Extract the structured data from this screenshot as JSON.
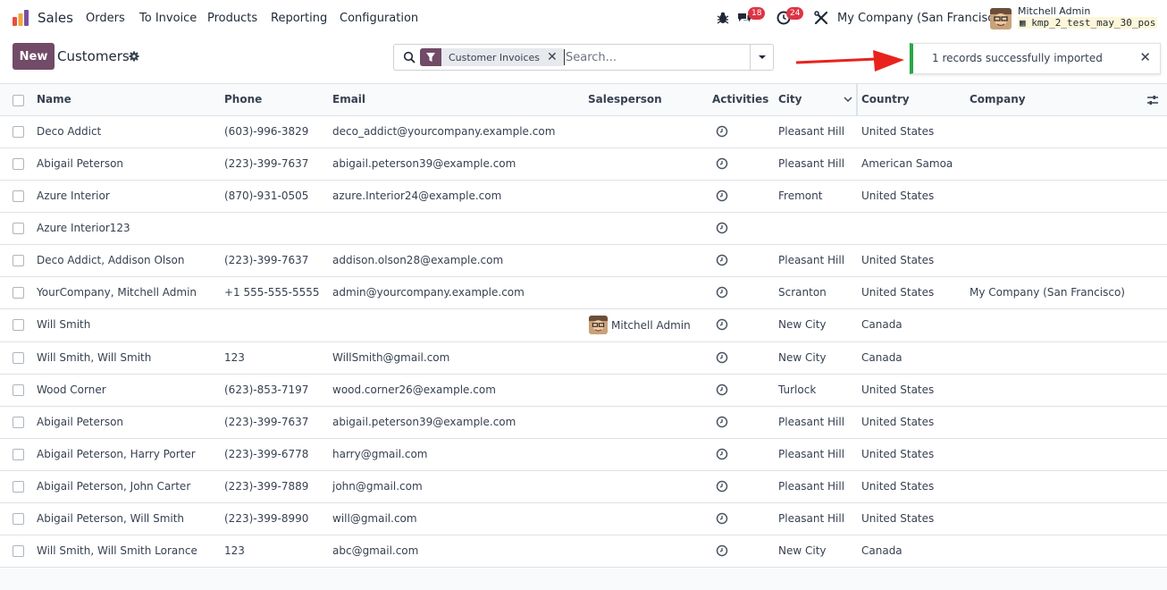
{
  "navbar": {
    "app_name": "Sales",
    "menu": [
      "Orders",
      "To Invoice",
      "Products",
      "Reporting",
      "Configuration"
    ],
    "messages_count": "18",
    "activities_count": "24",
    "company": "My Company (San Francisco)",
    "user_name": "Mitchell Admin",
    "database": "kmp_2_test_may_30_pos"
  },
  "control_panel": {
    "new_label": "New",
    "breadcrumb": "Customers"
  },
  "search": {
    "facet_label": "Customer Invoices",
    "placeholder": "Search..."
  },
  "notification": {
    "message": "1 records successfully imported"
  },
  "table": {
    "columns": [
      "Name",
      "Phone",
      "Email",
      "Salesperson",
      "Activities",
      "City",
      "Country",
      "Company"
    ],
    "rows": [
      {
        "name": "Deco Addict",
        "phone": "(603)-996-3829",
        "email": "deco_addict@yourcompany.example.com",
        "salesperson": "",
        "city": "Pleasant Hill",
        "country": "United States",
        "company": ""
      },
      {
        "name": "Abigail Peterson",
        "phone": "(223)-399-7637",
        "email": "abigail.peterson39@example.com",
        "salesperson": "",
        "city": "Pleasant Hill",
        "country": "American Samoa",
        "company": ""
      },
      {
        "name": "Azure Interior",
        "phone": "(870)-931-0505",
        "email": "azure.Interior24@example.com",
        "salesperson": "",
        "city": "Fremont",
        "country": "United States",
        "company": ""
      },
      {
        "name": "Azure Interior123",
        "phone": "",
        "email": "",
        "salesperson": "",
        "city": "",
        "country": "",
        "company": ""
      },
      {
        "name": "Deco Addict, Addison Olson",
        "phone": "(223)-399-7637",
        "email": "addison.olson28@example.com",
        "salesperson": "",
        "city": "Pleasant Hill",
        "country": "United States",
        "company": ""
      },
      {
        "name": "YourCompany, Mitchell Admin",
        "phone": "+1 555-555-5555",
        "email": "admin@yourcompany.example.com",
        "salesperson": "",
        "city": "Scranton",
        "country": "United States",
        "company": "My Company (San Francisco)"
      },
      {
        "name": "Will Smith",
        "phone": "",
        "email": "",
        "salesperson": "Mitchell Admin",
        "city": "New City",
        "country": "Canada",
        "company": ""
      },
      {
        "name": "Will Smith, Will Smith",
        "phone": "123",
        "email": "WillSmith@gmail.com",
        "salesperson": "",
        "city": "New City",
        "country": "Canada",
        "company": ""
      },
      {
        "name": "Wood Corner",
        "phone": "(623)-853-7197",
        "email": "wood.corner26@example.com",
        "salesperson": "",
        "city": "Turlock",
        "country": "United States",
        "company": ""
      },
      {
        "name": "Abigail Peterson",
        "phone": "(223)-399-7637",
        "email": "abigail.peterson39@example.com",
        "salesperson": "",
        "city": "Pleasant Hill",
        "country": "United States",
        "company": ""
      },
      {
        "name": "Abigail Peterson, Harry Porter",
        "phone": "(223)-399-6778",
        "email": "harry@gmail.com",
        "salesperson": "",
        "city": "Pleasant Hill",
        "country": "United States",
        "company": ""
      },
      {
        "name": "Abigail Peterson, John Carter",
        "phone": "(223)-399-7889",
        "email": "john@gmail.com",
        "salesperson": "",
        "city": "Pleasant Hill",
        "country": "United States",
        "company": ""
      },
      {
        "name": "Abigail Peterson, Will Smith",
        "phone": "(223)-399-8990",
        "email": "will@gmail.com",
        "salesperson": "",
        "city": "Pleasant Hill",
        "country": "United States",
        "company": ""
      },
      {
        "name": "Will Smith, Will Smith Lorance",
        "phone": "123",
        "email": "abc@gmail.com",
        "salesperson": "",
        "city": "New City",
        "country": "Canada",
        "company": ""
      }
    ]
  },
  "colors": {
    "primary": "#714b67",
    "badge": "#dc3545",
    "success": "#28a745",
    "arrow": "#e8231c"
  }
}
